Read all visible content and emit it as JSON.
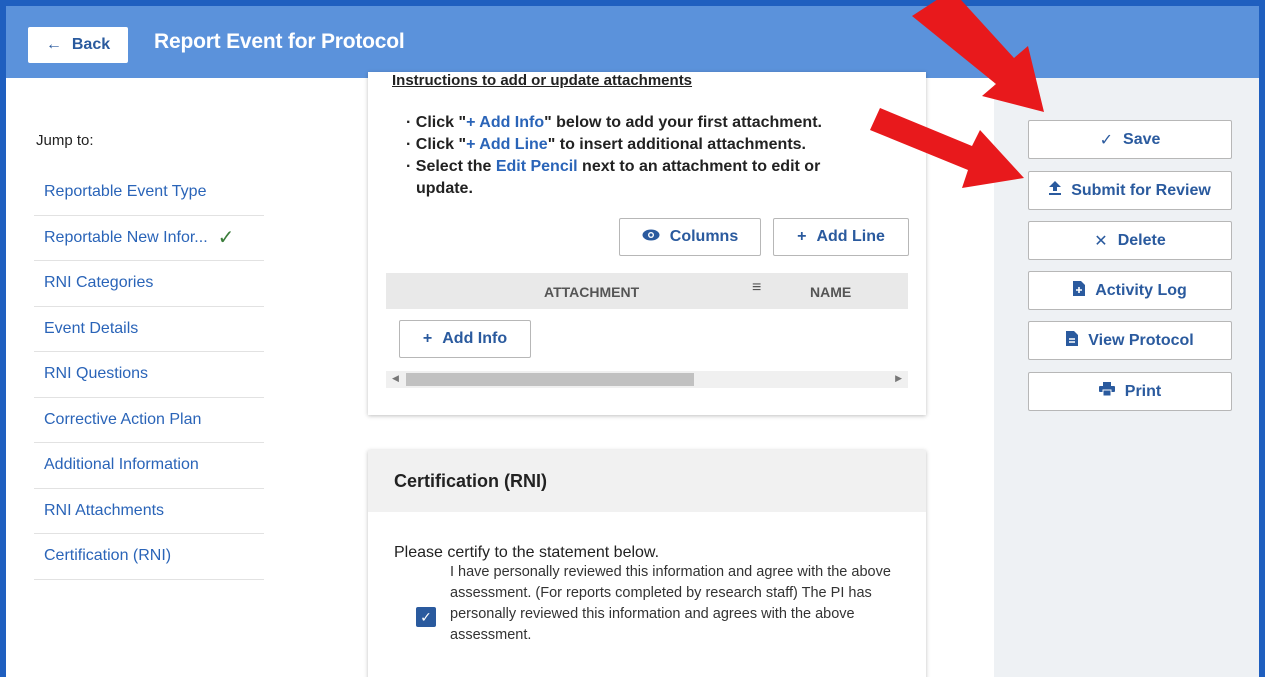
{
  "header": {
    "back_label": "Back",
    "title": "Report Event for Protocol"
  },
  "nav": {
    "jump_label": "Jump to:",
    "items": [
      {
        "label": "Reportable Event Type"
      },
      {
        "label": "Reportable New Infor...",
        "checked": true
      },
      {
        "label": "RNI Categories"
      },
      {
        "label": "Event Details"
      },
      {
        "label": "RNI Questions"
      },
      {
        "label": "Corrective Action Plan"
      },
      {
        "label": "Additional Information"
      },
      {
        "label": "RNI Attachments"
      },
      {
        "label": "Certification (RNI)"
      }
    ]
  },
  "attachments": {
    "instructions_title": "Instructions to add or update attachments",
    "instructions": {
      "line1_pre": "Click \"",
      "line1_link": "+ Add Info",
      "line1_post": "\" below to add your first attachment.",
      "line2_pre": "Click \"",
      "line2_link": "+ Add Line",
      "line2_post": "\" to insert additional attachments.",
      "line3_pre": "Select the ",
      "line3_link": "Edit Pencil",
      "line3_post": " next to an attachment to edit or update."
    },
    "columns_label": "Columns",
    "add_line_label": "Add Line",
    "table_headers": [
      "ATTACHMENT",
      "NAME"
    ],
    "add_info_label": "Add Info"
  },
  "certification": {
    "title": "Certification (RNI)",
    "prompt": "Please certify to the statement below.",
    "statement": "I have personally reviewed this information and agree with the above assessment. (For reports completed by research staff) The PI has personally reviewed this information and agrees with the above assessment.",
    "checked": true
  },
  "actions": {
    "save": "Save",
    "submit": "Submit for Review",
    "delete": "Delete",
    "activity_log": "Activity Log",
    "view_protocol": "View Protocol",
    "print": "Print"
  },
  "colors": {
    "header_bg": "#5b92db",
    "link_blue": "#2a64b8",
    "annotation_arrow": "#e8191c"
  }
}
